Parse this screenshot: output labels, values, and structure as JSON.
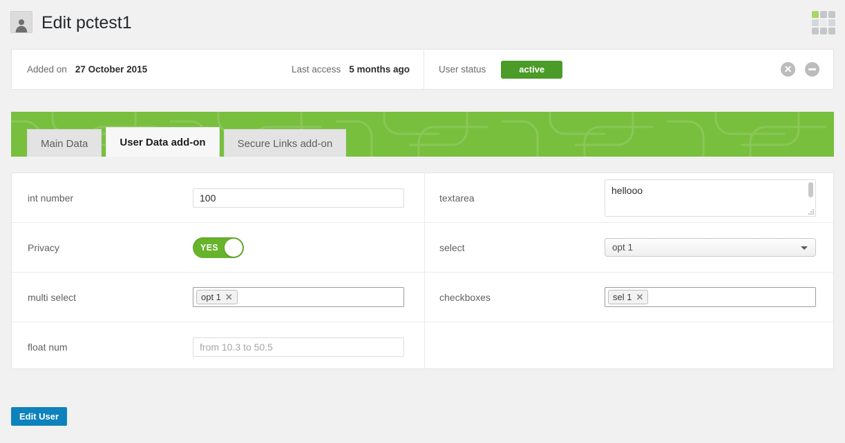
{
  "header": {
    "title": "Edit pctest1",
    "avatar_icon": "user-avatar-icon",
    "grid_icon": "apps-grid-icon"
  },
  "info_bar": {
    "added_label": "Added on",
    "added_value": "27 October 2015",
    "last_access_label": "Last access",
    "last_access_value": "5 months ago",
    "user_status_label": "User status",
    "user_status_value": "active",
    "status_color": "#4a9b27",
    "delete_icon": "circle-x-icon",
    "block_icon": "circle-minus-icon"
  },
  "tabs": [
    {
      "label": "Main Data",
      "active": false
    },
    {
      "label": "User Data add-on",
      "active": true
    },
    {
      "label": "Secure Links add-on",
      "active": false
    }
  ],
  "tabbar_color": "#78bf3e",
  "form": {
    "left": [
      {
        "label": "int number",
        "type": "text",
        "value": "100",
        "placeholder": ""
      },
      {
        "label": "Privacy",
        "type": "toggle",
        "value": "YES"
      },
      {
        "label": "multi select",
        "type": "tags",
        "tags": [
          "opt 1"
        ]
      },
      {
        "label": "float num",
        "type": "text",
        "value": "",
        "placeholder": "from 10.3 to 50.5"
      }
    ],
    "right": [
      {
        "label": "textarea",
        "type": "textarea",
        "value": "hellooo"
      },
      {
        "label": "select",
        "type": "select",
        "value": "opt 1"
      },
      {
        "label": "checkboxes",
        "type": "tags",
        "tags": [
          "sel 1"
        ]
      },
      {
        "label": "",
        "type": "empty"
      }
    ]
  },
  "submit": {
    "label": "Edit User",
    "color": "#0d82bd"
  }
}
